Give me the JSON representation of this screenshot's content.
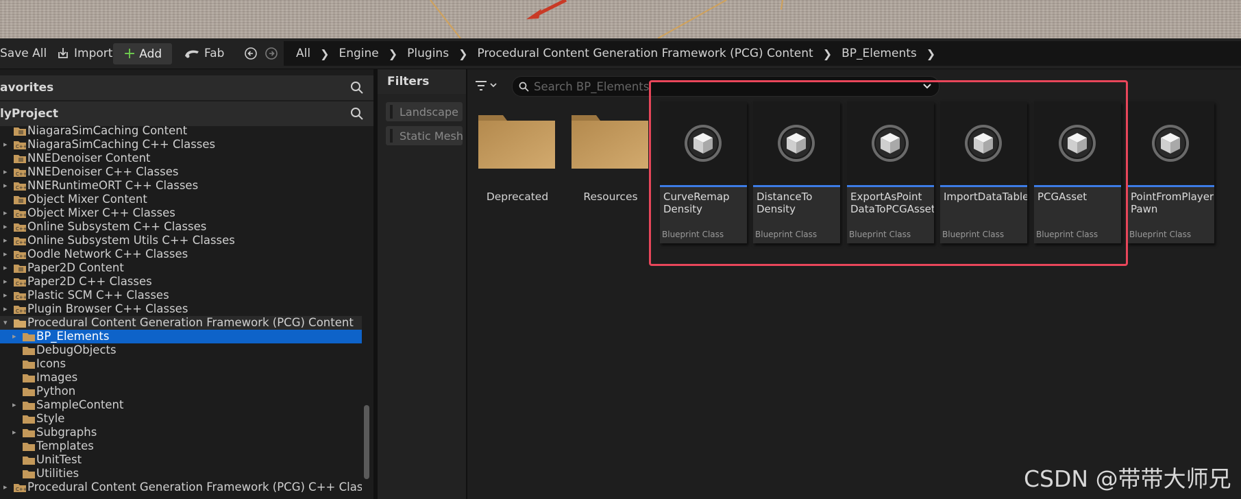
{
  "toolbar": {
    "save_all": "Save All",
    "import": "Import",
    "add": "Add",
    "fab": "Fab"
  },
  "breadcrumb": [
    "All",
    "Engine",
    "Plugins",
    "Procedural Content Generation Framework (PCG) Content",
    "BP_Elements"
  ],
  "left_panel": {
    "favorites_title": "avorites",
    "project_title": "lyProject",
    "tree": [
      {
        "label": "NiagaraSimCaching Content",
        "level": 0,
        "arrow": "none",
        "icon": "content-folder"
      },
      {
        "label": "NiagaraSimCaching C++ Classes",
        "level": 0,
        "arrow": "right",
        "icon": "cpp-folder"
      },
      {
        "label": "NNEDenoiser Content",
        "level": 0,
        "arrow": "none",
        "icon": "content-folder"
      },
      {
        "label": "NNEDenoiser C++ Classes",
        "level": 0,
        "arrow": "right",
        "icon": "cpp-folder"
      },
      {
        "label": "NNERuntimeORT C++ Classes",
        "level": 0,
        "arrow": "right",
        "icon": "cpp-folder"
      },
      {
        "label": "Object Mixer Content",
        "level": 0,
        "arrow": "none",
        "icon": "content-folder"
      },
      {
        "label": "Object Mixer C++ Classes",
        "level": 0,
        "arrow": "right",
        "icon": "cpp-folder"
      },
      {
        "label": "Online Subsystem C++ Classes",
        "level": 0,
        "arrow": "right",
        "icon": "cpp-folder"
      },
      {
        "label": "Online Subsystem Utils C++ Classes",
        "level": 0,
        "arrow": "right",
        "icon": "cpp-folder"
      },
      {
        "label": "Oodle Network C++ Classes",
        "level": 0,
        "arrow": "right",
        "icon": "cpp-folder"
      },
      {
        "label": "Paper2D Content",
        "level": 0,
        "arrow": "right",
        "icon": "content-folder"
      },
      {
        "label": "Paper2D C++ Classes",
        "level": 0,
        "arrow": "right",
        "icon": "cpp-folder"
      },
      {
        "label": "Plastic SCM C++ Classes",
        "level": 0,
        "arrow": "right",
        "icon": "cpp-folder"
      },
      {
        "label": "Plugin Browser C++ Classes",
        "level": 0,
        "arrow": "right",
        "icon": "cpp-folder"
      },
      {
        "label": "Procedural Content Generation Framework (PCG) Content",
        "level": 0,
        "arrow": "down",
        "icon": "open-folder",
        "state": "highlight"
      },
      {
        "label": "BP_Elements",
        "level": 1,
        "arrow": "right",
        "icon": "folder",
        "state": "selected"
      },
      {
        "label": "DebugObjects",
        "level": 1,
        "arrow": "none",
        "icon": "folder"
      },
      {
        "label": "Icons",
        "level": 1,
        "arrow": "none",
        "icon": "folder"
      },
      {
        "label": "Images",
        "level": 1,
        "arrow": "none",
        "icon": "folder"
      },
      {
        "label": "Python",
        "level": 1,
        "arrow": "none",
        "icon": "folder"
      },
      {
        "label": "SampleContent",
        "level": 1,
        "arrow": "right",
        "icon": "folder"
      },
      {
        "label": "Style",
        "level": 1,
        "arrow": "none",
        "icon": "folder"
      },
      {
        "label": "Subgraphs",
        "level": 1,
        "arrow": "right",
        "icon": "folder"
      },
      {
        "label": "Templates",
        "level": 1,
        "arrow": "none",
        "icon": "folder"
      },
      {
        "label": "UnitTest",
        "level": 1,
        "arrow": "none",
        "icon": "folder"
      },
      {
        "label": "Utilities",
        "level": 1,
        "arrow": "none",
        "icon": "folder"
      },
      {
        "label": "Procedural Content Generation Framework (PCG) C++ Classes",
        "level": 0,
        "arrow": "right",
        "icon": "cpp-folder"
      }
    ]
  },
  "filters": {
    "title": "Filters",
    "items": [
      "Landscape (",
      "Static Mesh"
    ]
  },
  "search": {
    "placeholder": "Search BP_Elements"
  },
  "folders": [
    {
      "name": "Deprecated"
    },
    {
      "name": "Resources"
    }
  ],
  "assets": [
    {
      "name": "CurveRemap\nDensity",
      "type": "Blueprint Class"
    },
    {
      "name": "DistanceTo\nDensity",
      "type": "Blueprint Class"
    },
    {
      "name": "ExportAsPoint\nDataToPCGAsset",
      "type": "Blueprint Class"
    },
    {
      "name": "ImportDataTable",
      "type": "Blueprint Class"
    },
    {
      "name": "PCGAsset",
      "type": "Blueprint Class"
    },
    {
      "name": "PointFromPlayer\nPawn",
      "type": "Blueprint Class"
    }
  ],
  "colors": {
    "selection": "#0e63c9",
    "highlight_box": "#e8465a",
    "asset_strip": "#3c7ce6",
    "folder": "#c4995a"
  },
  "watermark": "CSDN @带带大师兄"
}
